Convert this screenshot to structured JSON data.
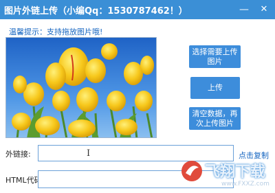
{
  "window": {
    "title": "图片外链上传（小编Qq：1530787462！）",
    "minimize_glyph": "—",
    "close_glyph": "✕"
  },
  "tip": "温馨提示：支持拖放图片哦!",
  "preview": {
    "image_subject": "yellow tulips under blue sky"
  },
  "buttons": {
    "select": "选择需要上传图片",
    "upload": "上传",
    "clear": "清空数据，再次上传图片"
  },
  "fields": {
    "link_label": "外链接:",
    "link_value": "",
    "html_label": "HTML代码:",
    "html_value": ""
  },
  "copy_link": "点击复制",
  "watermark": {
    "brand": "飞翔下载",
    "url": "www.FXXZ.com"
  },
  "colors": {
    "titlebar": "#3b8fd6",
    "button": "#3d8ddb",
    "accent_text": "#1565c0"
  }
}
